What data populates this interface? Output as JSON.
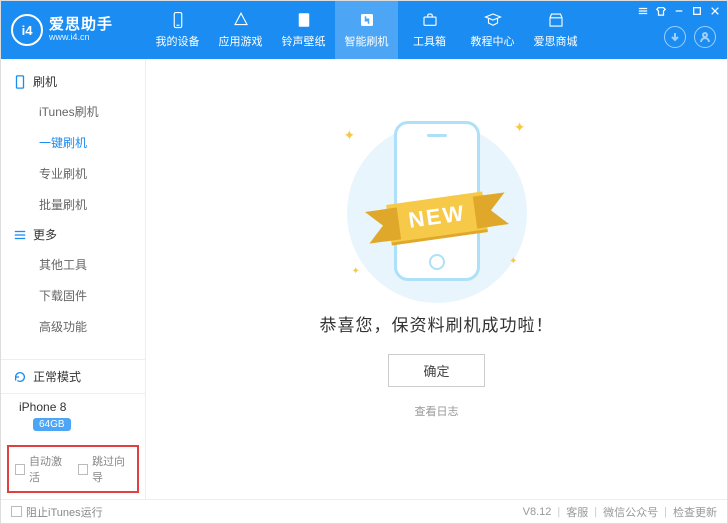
{
  "brand": {
    "logo_text": "i4",
    "title": "爱思助手",
    "subtitle": "www.i4.cn"
  },
  "nav": {
    "items": [
      {
        "label": "我的设备"
      },
      {
        "label": "应用游戏"
      },
      {
        "label": "铃声壁纸"
      },
      {
        "label": "智能刷机"
      },
      {
        "label": "工具箱"
      },
      {
        "label": "教程中心"
      },
      {
        "label": "爱思商城"
      }
    ]
  },
  "sidebar": {
    "group1": {
      "title": "刷机",
      "items": [
        "iTunes刷机",
        "一键刷机",
        "专业刷机",
        "批量刷机"
      ]
    },
    "group2": {
      "title": "更多",
      "items": [
        "其他工具",
        "下载固件",
        "高级功能"
      ]
    },
    "status_label": "正常模式",
    "device_name": "iPhone 8",
    "device_storage": "64GB",
    "check_auto_activate": "自动激活",
    "check_skip_guide": "跳过向导"
  },
  "main": {
    "ribbon_text": "NEW",
    "success_text": "恭喜您，保资料刷机成功啦！",
    "confirm_label": "确定",
    "log_link": "查看日志"
  },
  "footer": {
    "block_itunes": "阻止iTunes运行",
    "version": "V8.12",
    "support": "客服",
    "wechat": "微信公众号",
    "update": "检查更新"
  }
}
